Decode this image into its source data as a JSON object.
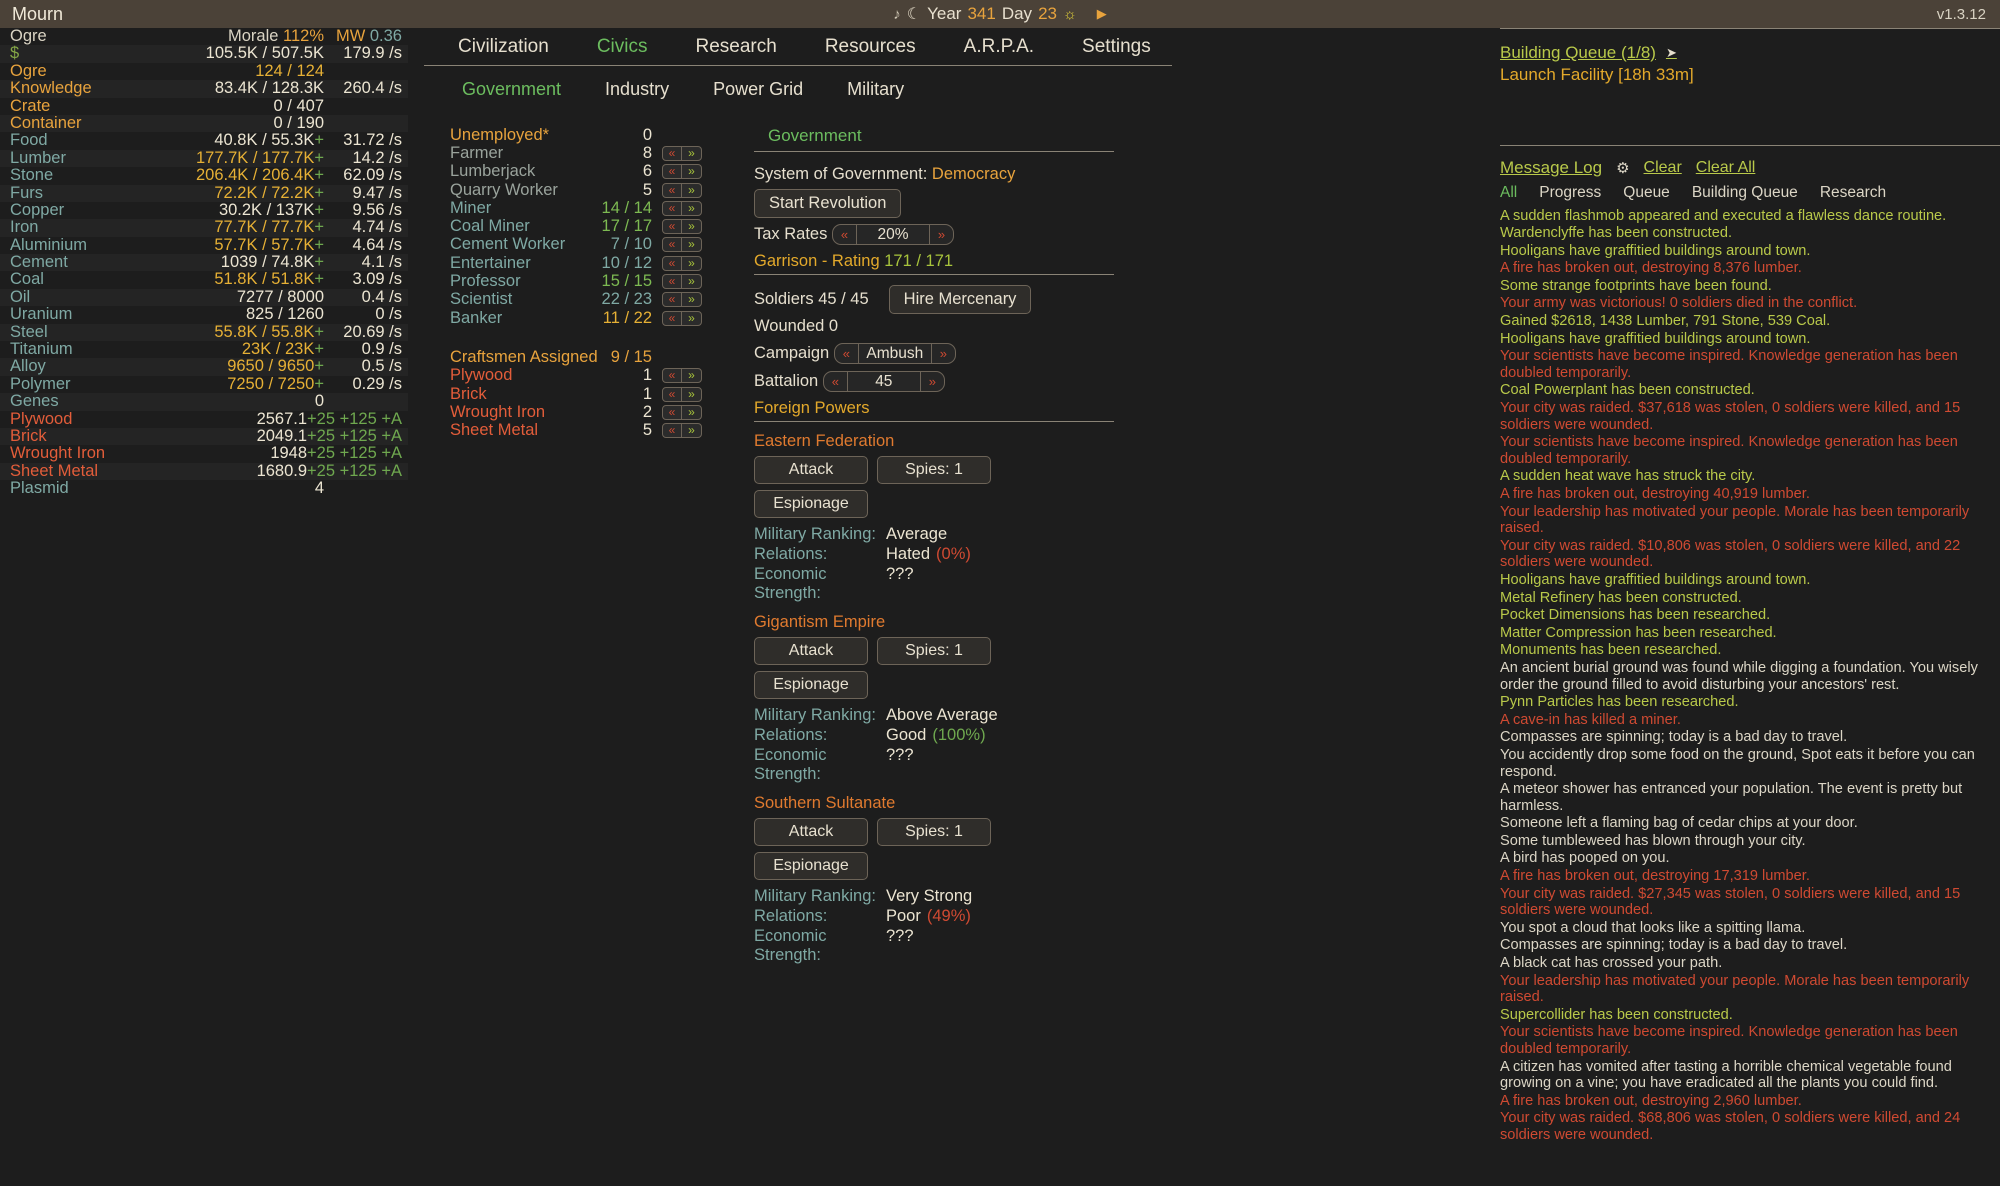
{
  "topbar": {
    "title": "Mourn",
    "music_icon": "music-note-icon",
    "moon_icon": "moon-icon",
    "year_label": "Year",
    "year_value": "341",
    "day_label": "Day",
    "day_value": "23",
    "sun_icon": "sun-icon",
    "play_icon": "play-icon",
    "version": "v1.3.12"
  },
  "resources": {
    "header": {
      "name": "Ogre",
      "morale_label": "Morale",
      "morale_value": "112%",
      "mw_label": "MW",
      "mw_value": "0.36"
    },
    "rows": [
      {
        "name": "$",
        "name_color": "c-money",
        "amount": "105.5K / 507.5K",
        "amount_color": "c-cream",
        "rate": "179.9 /s"
      },
      {
        "name": "Ogre",
        "name_color": "c-gold",
        "amount": "124 / 124",
        "amount_color": "c-amber",
        "rate": ""
      },
      {
        "name": "Knowledge",
        "name_color": "c-gold",
        "amount": "83.4K / 128.3K",
        "amount_color": "c-cream",
        "rate": "260.4 /s"
      },
      {
        "name": "Crate",
        "name_color": "c-gold",
        "amount": "0 / 407",
        "amount_color": "c-cream",
        "rate": ""
      },
      {
        "name": "Container",
        "name_color": "c-gold",
        "amount": "0 / 190",
        "amount_color": "c-cream",
        "rate": ""
      },
      {
        "name": "Food",
        "name_color": "c-teal",
        "amount": "40.8K / 55.3K",
        "amount_color": "c-cream",
        "plus": "+",
        "rate": "31.72 /s"
      },
      {
        "name": "Lumber",
        "name_color": "c-teal",
        "amount": "177.7K / 177.7K",
        "amount_color": "c-amber",
        "plus": "+",
        "rate": "14.2 /s"
      },
      {
        "name": "Stone",
        "name_color": "c-teal",
        "amount": "206.4K / 206.4K",
        "amount_color": "c-amber",
        "plus": "+",
        "rate": "62.09 /s"
      },
      {
        "name": "Furs",
        "name_color": "c-teal",
        "amount": "72.2K / 72.2K",
        "amount_color": "c-amber",
        "plus": "+",
        "rate": "9.47 /s"
      },
      {
        "name": "Copper",
        "name_color": "c-teal",
        "amount": "30.2K / 137K",
        "amount_color": "c-cream",
        "plus": "+",
        "rate": "9.56 /s"
      },
      {
        "name": "Iron",
        "name_color": "c-teal",
        "amount": "77.7K / 77.7K",
        "amount_color": "c-amber",
        "plus": "+",
        "rate": "4.74 /s"
      },
      {
        "name": "Aluminium",
        "name_color": "c-teal",
        "amount": "57.7K / 57.7K",
        "amount_color": "c-amber",
        "plus": "+",
        "rate": "4.64 /s"
      },
      {
        "name": "Cement",
        "name_color": "c-teal",
        "amount": "1039 / 74.8K",
        "amount_color": "c-cream",
        "plus": "+",
        "rate": "4.1 /s"
      },
      {
        "name": "Coal",
        "name_color": "c-teal",
        "amount": "51.8K / 51.8K",
        "amount_color": "c-amber",
        "plus": "+",
        "rate": "3.09 /s"
      },
      {
        "name": "Oil",
        "name_color": "c-teal",
        "amount": "7277 / 8000",
        "amount_color": "c-cream",
        "rate": "0.4 /s"
      },
      {
        "name": "Uranium",
        "name_color": "c-teal",
        "amount": "825 / 1260",
        "amount_color": "c-cream",
        "rate": "0 /s"
      },
      {
        "name": "Steel",
        "name_color": "c-teal",
        "amount": "55.8K / 55.8K",
        "amount_color": "c-amber",
        "plus": "+",
        "rate": "20.69 /s"
      },
      {
        "name": "Titanium",
        "name_color": "c-teal",
        "amount": "23K / 23K",
        "amount_color": "c-amber",
        "plus": "+",
        "rate": "0.9 /s"
      },
      {
        "name": "Alloy",
        "name_color": "c-teal",
        "amount": "9650 / 9650",
        "amount_color": "c-amber",
        "plus": "+",
        "rate": "0.5 /s"
      },
      {
        "name": "Polymer",
        "name_color": "c-teal",
        "amount": "7250 / 7250",
        "amount_color": "c-amber",
        "plus": "+",
        "rate": "0.29 /s"
      },
      {
        "name": "Genes",
        "name_color": "c-teal",
        "amount": "0",
        "amount_color": "c-cream",
        "rate": ""
      },
      {
        "name": "Plywood",
        "name_color": "c-red",
        "amount": "2567.1",
        "amount_color": "c-cream",
        "rate": "+25 +125 +A"
      },
      {
        "name": "Brick",
        "name_color": "c-red",
        "amount": "2049.1",
        "amount_color": "c-cream",
        "rate": "+25 +125 +A"
      },
      {
        "name": "Wrought Iron",
        "name_color": "c-red",
        "amount": "1948",
        "amount_color": "c-cream",
        "rate": "+25 +125 +A"
      },
      {
        "name": "Sheet Metal",
        "name_color": "c-red",
        "amount": "1680.9",
        "amount_color": "c-cream",
        "rate": "+25 +125 +A"
      },
      {
        "name": "Plasmid",
        "name_color": "c-teal",
        "amount": "4",
        "amount_color": "c-cream",
        "rate": ""
      }
    ]
  },
  "nav": {
    "tabs": [
      {
        "label": "Civilization",
        "active": false
      },
      {
        "label": "Civics",
        "active": true
      },
      {
        "label": "Research",
        "active": false
      },
      {
        "label": "Resources",
        "active": false
      },
      {
        "label": "A.R.P.A.",
        "active": false
      },
      {
        "label": "Settings",
        "active": false
      }
    ],
    "subtabs": [
      {
        "label": "Government",
        "active": true
      },
      {
        "label": "Industry",
        "active": false
      },
      {
        "label": "Power Grid",
        "active": false
      },
      {
        "label": "Military",
        "active": false
      }
    ]
  },
  "jobs": {
    "rows": [
      {
        "name": "Unemployed*",
        "name_color": "c-gold",
        "count": "0",
        "count_color": "c-cream",
        "has_ctrl": false
      },
      {
        "name": "Farmer",
        "name_color": "c-grey",
        "count": "8",
        "count_color": "c-cream",
        "has_ctrl": true
      },
      {
        "name": "Lumberjack",
        "name_color": "c-grey",
        "count": "6",
        "count_color": "c-cream",
        "has_ctrl": true
      },
      {
        "name": "Quarry Worker",
        "name_color": "c-grey",
        "count": "5",
        "count_color": "c-cream",
        "has_ctrl": true
      },
      {
        "name": "Miner",
        "name_color": "c-teal",
        "count": "14 / 14",
        "count_color": "c-vgreen",
        "has_ctrl": true
      },
      {
        "name": "Coal Miner",
        "name_color": "c-teal",
        "count": "17 / 17",
        "count_color": "c-vgreen",
        "has_ctrl": true
      },
      {
        "name": "Cement Worker",
        "name_color": "c-teal",
        "count": "7 / 10",
        "count_color": "c-teal",
        "has_ctrl": true
      },
      {
        "name": "Entertainer",
        "name_color": "c-teal",
        "count": "10 / 12",
        "count_color": "c-teal",
        "has_ctrl": true
      },
      {
        "name": "Professor",
        "name_color": "c-teal",
        "count": "15 / 15",
        "count_color": "c-vgreen",
        "has_ctrl": true
      },
      {
        "name": "Scientist",
        "name_color": "c-teal",
        "count": "22 / 23",
        "count_color": "c-teal",
        "has_ctrl": true
      },
      {
        "name": "Banker",
        "name_color": "c-teal",
        "count": "11 / 22",
        "count_color": "c-amber",
        "has_ctrl": true
      }
    ],
    "craftsmen_label": "Craftsmen Assigned",
    "craftsmen_value": "9 / 15",
    "craft_rows": [
      {
        "name": "Plywood",
        "count": "1",
        "has_ctrl": true
      },
      {
        "name": "Brick",
        "count": "1",
        "has_ctrl": true
      },
      {
        "name": "Wrought Iron",
        "count": "2",
        "has_ctrl": true
      },
      {
        "name": "Sheet Metal",
        "count": "5",
        "has_ctrl": true
      }
    ]
  },
  "government": {
    "panel_title": "Government",
    "system_label": "System of Government:",
    "system_value": "Democracy",
    "revolution_button": "Start Revolution",
    "tax_label": "Tax Rates",
    "tax_value": "20%",
    "garrison_title": "Garrison - Rating",
    "garrison_rating": "171 / 171",
    "soldiers_label": "Soldiers 45 / 45",
    "hire_button": "Hire Mercenary",
    "wounded_label": "Wounded 0",
    "campaign_label": "Campaign",
    "campaign_value": "Ambush",
    "battalion_label": "Battalion",
    "battalion_value": "45",
    "foreign_title": "Foreign Powers",
    "powers": [
      {
        "name": "Eastern Federation",
        "attack_button": "Attack",
        "spies_button": "Spies: 1",
        "espionage_button": "Espionage",
        "ranking_label": "Military Ranking:",
        "ranking_value": "Average",
        "relations_label": "Relations:",
        "relations_value": "Hated",
        "relations_pct": "(0%)",
        "relations_mod": "mod-bad",
        "economic_label": "Economic Strength:",
        "economic_value": "???"
      },
      {
        "name": "Gigantism Empire",
        "attack_button": "Attack",
        "spies_button": "Spies: 1",
        "espionage_button": "Espionage",
        "ranking_label": "Military Ranking:",
        "ranking_value": "Above Average",
        "relations_label": "Relations:",
        "relations_value": "Good",
        "relations_pct": "(100%)",
        "relations_mod": "mod-good",
        "economic_label": "Economic Strength:",
        "economic_value": "???"
      },
      {
        "name": "Southern Sultanate",
        "attack_button": "Attack",
        "spies_button": "Spies: 1",
        "espionage_button": "Espionage",
        "ranking_label": "Military Ranking:",
        "ranking_value": "Very Strong",
        "relations_label": "Relations:",
        "relations_value": "Poor",
        "relations_pct": "(49%)",
        "relations_mod": "mod-bad",
        "economic_label": "Economic Strength:",
        "economic_value": "???"
      }
    ]
  },
  "queue": {
    "title": "Building Queue (1/8)",
    "arrow_icon": "chevron-right-icon",
    "items": [
      "Launch Facility [18h 33m]"
    ]
  },
  "message_log": {
    "title": "Message Log",
    "gear_icon": "gear-icon",
    "clear_label": "Clear",
    "clear_all_label": "Clear All",
    "tabs": [
      {
        "label": "All",
        "active": true
      },
      {
        "label": "Progress",
        "active": false
      },
      {
        "label": "Queue",
        "active": false
      },
      {
        "label": "Building Queue",
        "active": false
      },
      {
        "label": "Research",
        "active": false
      }
    ],
    "entries": [
      {
        "text": "A sudden flashmob appeared and executed a flawless dance routine.",
        "cls": "m-info"
      },
      {
        "text": "Wardenclyffe has been constructed.",
        "cls": "m-info"
      },
      {
        "text": "Hooligans have graffitied buildings around town.",
        "cls": "m-info"
      },
      {
        "text": "A fire has broken out, destroying 8,376 lumber.",
        "cls": "m-warn"
      },
      {
        "text": "Some strange footprints have been found.",
        "cls": "m-info"
      },
      {
        "text": "Your army was victorious! 0 soldiers died in the conflict.",
        "cls": "m-warn"
      },
      {
        "text": "Gained $2618, 1438 Lumber, 791 Stone, 539 Coal.",
        "cls": "m-info"
      },
      {
        "text": "Hooligans have graffitied buildings around town.",
        "cls": "m-info"
      },
      {
        "text": "Your scientists have become inspired. Knowledge generation has been doubled temporarily.",
        "cls": "m-warn"
      },
      {
        "text": "Coal Powerplant has been constructed.",
        "cls": "m-info"
      },
      {
        "text": "Your city was raided. $37,618 was stolen, 0 soldiers were killed, and 15 soldiers were wounded.",
        "cls": "m-warn"
      },
      {
        "text": "Your scientists have become inspired. Knowledge generation has been doubled temporarily.",
        "cls": "m-warn"
      },
      {
        "text": "A sudden heat wave has struck the city.",
        "cls": "m-info"
      },
      {
        "text": "A fire has broken out, destroying 40,919 lumber.",
        "cls": "m-warn"
      },
      {
        "text": "Your leadership has motivated your people. Morale has been temporarily raised.",
        "cls": "m-warn"
      },
      {
        "text": "Your city was raided. $10,806 was stolen, 0 soldiers were killed, and 22 soldiers were wounded.",
        "cls": "m-warn"
      },
      {
        "text": "Hooligans have graffitied buildings around town.",
        "cls": "m-info"
      },
      {
        "text": "Metal Refinery has been constructed.",
        "cls": "m-info"
      },
      {
        "text": "Pocket Dimensions has been researched.",
        "cls": "m-info"
      },
      {
        "text": "Matter Compression has been researched.",
        "cls": "m-info"
      },
      {
        "text": "Monuments has been researched.",
        "cls": "m-info"
      },
      {
        "text": "An ancient burial ground was found while digging a foundation. You wisely order the ground filled to avoid disturbing your ancestors' rest.",
        "cls": "m-plain"
      },
      {
        "text": "Pynn Particles has been researched.",
        "cls": "m-info"
      },
      {
        "text": "A cave-in has killed a miner.",
        "cls": "m-warn"
      },
      {
        "text": "Compasses are spinning; today is a bad day to travel.",
        "cls": "m-plain"
      },
      {
        "text": "You accidently drop some food on the ground, Spot eats it before you can respond.",
        "cls": "m-plain"
      },
      {
        "text": "A meteor shower has entranced your population. The event is pretty but harmless.",
        "cls": "m-plain"
      },
      {
        "text": "Someone left a flaming bag of cedar chips at your door.",
        "cls": "m-plain"
      },
      {
        "text": "Some tumbleweed has blown through your city.",
        "cls": "m-plain"
      },
      {
        "text": "A bird has pooped on you.",
        "cls": "m-plain"
      },
      {
        "text": "A fire has broken out, destroying 17,319 lumber.",
        "cls": "m-warn"
      },
      {
        "text": "Your city was raided. $27,345 was stolen, 0 soldiers were killed, and 15 soldiers were wounded.",
        "cls": "m-warn"
      },
      {
        "text": "You spot a cloud that looks like a spitting llama.",
        "cls": "m-plain"
      },
      {
        "text": "Compasses are spinning; today is a bad day to travel.",
        "cls": "m-plain"
      },
      {
        "text": "A black cat has crossed your path.",
        "cls": "m-plain"
      },
      {
        "text": "Your leadership has motivated your people. Morale has been temporarily raised.",
        "cls": "m-warn"
      },
      {
        "text": "Supercollider has been constructed.",
        "cls": "m-info"
      },
      {
        "text": "Your scientists have become inspired. Knowledge generation has been doubled temporarily.",
        "cls": "m-warn"
      },
      {
        "text": "A citizen has vomited after tasting a horrible chemical vegetable found growing on a vine; you have eradicated all the plants you could find.",
        "cls": "m-plain"
      },
      {
        "text": "A fire has broken out, destroying 2,960 lumber.",
        "cls": "m-warn"
      },
      {
        "text": "Your city was raided. $68,806 was stolen, 0 soldiers were killed, and 24 soldiers were wounded.",
        "cls": "m-warn"
      }
    ]
  }
}
